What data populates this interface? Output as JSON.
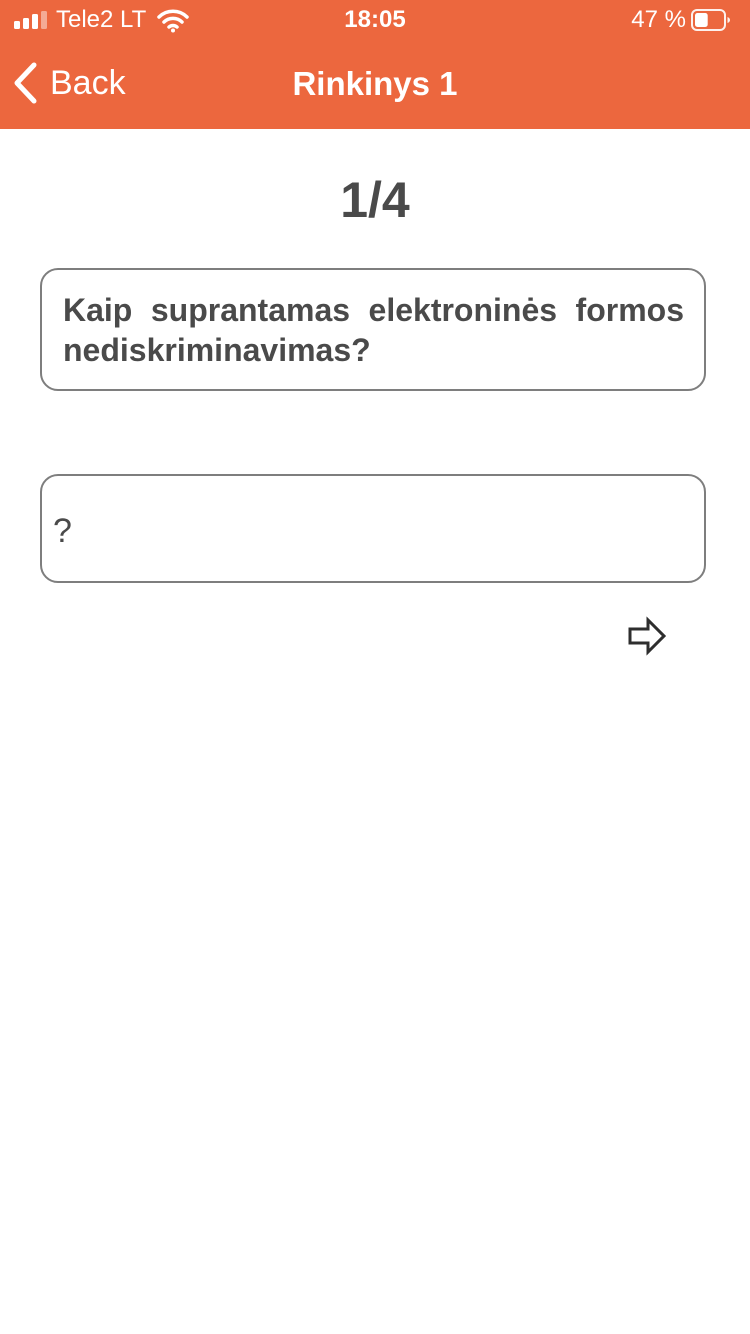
{
  "status_bar": {
    "carrier": "Tele2 LT",
    "signal_bars": 3,
    "time": "18:05",
    "battery_percent": "47 %",
    "battery_level": 0.47
  },
  "nav": {
    "back_label": "Back",
    "title": "Rinkinys 1"
  },
  "card": {
    "counter": "1/4",
    "question": "Kaip suprantamas elektroninės formos nediskriminavimas?",
    "answer": "?"
  },
  "icons": {
    "back": "chevron-left-icon",
    "next": "arrow-right-icon",
    "wifi": "wifi-icon",
    "battery": "battery-icon",
    "signal": "signal-icon"
  },
  "colors": {
    "header_bg": "#EC673E",
    "text_primary": "#4A4A4A",
    "card_border": "#7E7E7E",
    "background": "#FFFFFF"
  }
}
